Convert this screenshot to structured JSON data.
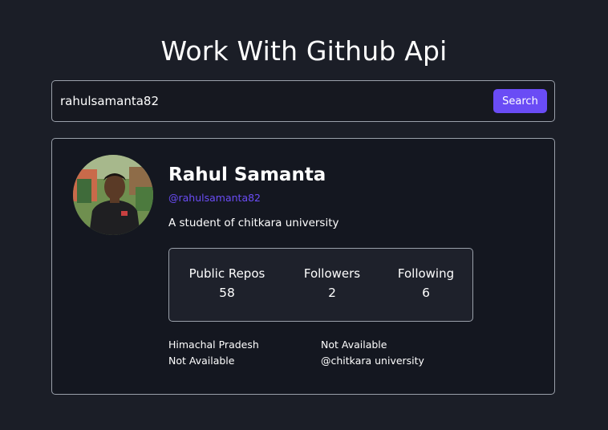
{
  "page": {
    "title": "Work With Github Api"
  },
  "search": {
    "value": "rahulsamanta82",
    "button_label": "Search"
  },
  "profile": {
    "name": "Rahul Samanta",
    "handle": "@rahulsamanta82",
    "bio": "A student of chitkara university",
    "stats": {
      "repos_label": "Public Repos",
      "repos_value": "58",
      "followers_label": "Followers",
      "followers_value": "2",
      "following_label": "Following",
      "following_value": "6"
    },
    "info": {
      "location": "Himachal Pradesh",
      "blog": "Not Available",
      "twitter": "Not Available",
      "company": "@chitkara university"
    }
  },
  "colors": {
    "background": "#1b1e27",
    "card": "#141720",
    "accent": "#6a4cf5",
    "border": "#9aa0aa"
  }
}
